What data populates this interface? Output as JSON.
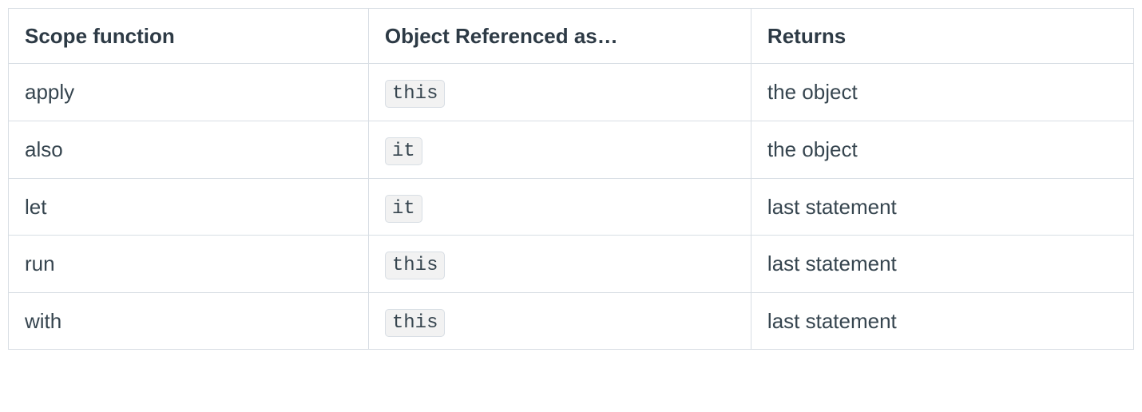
{
  "table": {
    "headers": [
      "Scope function",
      "Object Referenced as…",
      "Returns"
    ],
    "rows": [
      {
        "func": "apply",
        "ref": "this",
        "refIsCode": true,
        "returns": "the object"
      },
      {
        "func": "also",
        "ref": "it",
        "refIsCode": true,
        "returns": "the object"
      },
      {
        "func": "let",
        "ref": "it",
        "refIsCode": true,
        "returns": "last statement"
      },
      {
        "func": "run",
        "ref": "this",
        "refIsCode": true,
        "returns": "last statement"
      },
      {
        "func": "with",
        "ref": "this",
        "refIsCode": true,
        "returns": "last statement"
      }
    ]
  }
}
